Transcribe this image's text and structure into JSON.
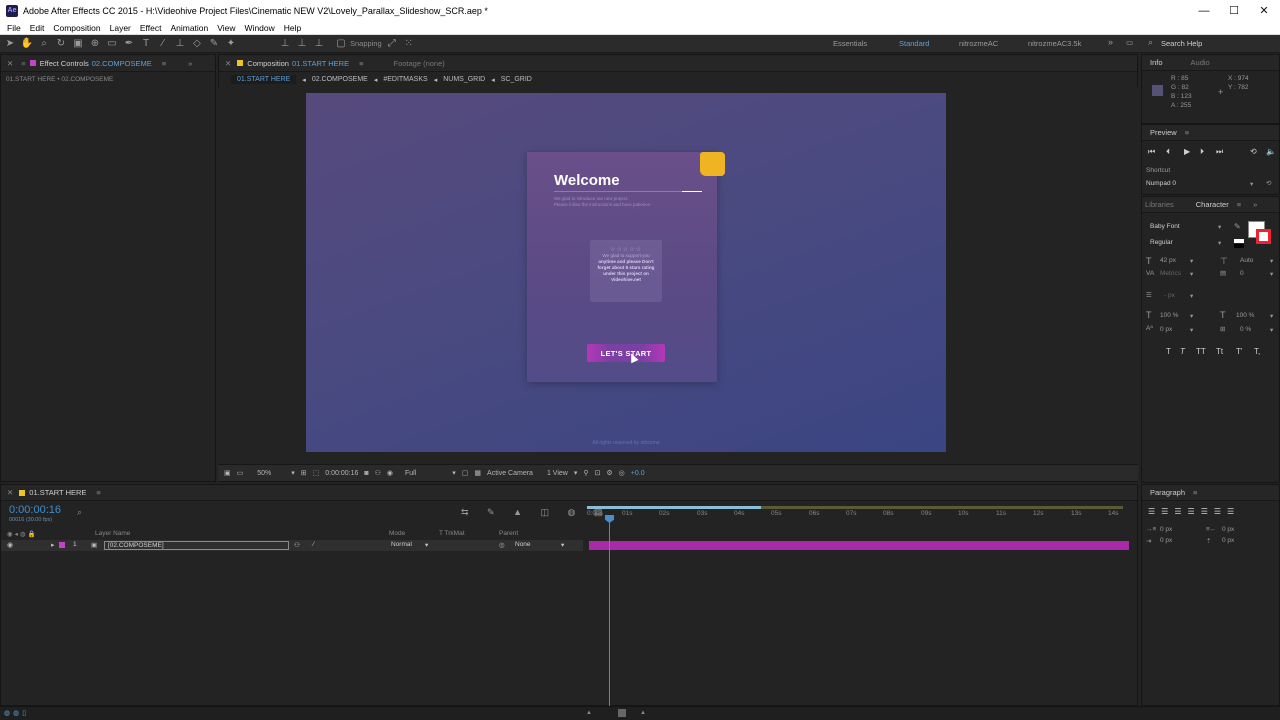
{
  "window": {
    "title": "Adobe After Effects CC 2015 - H:\\Videohive Project Files\\Cinematic NEW V2\\Lovely_Parallax_Slideshow_SCR.aep *",
    "app_icon": "Ae"
  },
  "menu": [
    "File",
    "Edit",
    "Composition",
    "Layer",
    "Effect",
    "Animation",
    "View",
    "Window",
    "Help"
  ],
  "toolbar": {
    "snapping_label": "Snapping",
    "workspaces": [
      "Essentials",
      "Standard",
      "nitrozmeAC",
      "nitrozmeAC3.5k"
    ],
    "active_workspace": "Standard",
    "search_placeholder": "Search Help"
  },
  "effect_controls": {
    "tab_label": "Effect Controls",
    "tab_target": "02.COMPOSEME",
    "breadcrumb": "01.START HERE • 02.COMPOSEME"
  },
  "composition": {
    "tab_label": "Composition",
    "tab_target": "01.START HERE",
    "footage_label": "Footage (none)",
    "nav_tabs": [
      "01.START HERE",
      "02.COMPOSEME",
      "#EDITMASKS",
      "NUMS_GRID",
      "SC_GRID"
    ],
    "active_nav": "01.START HERE"
  },
  "canvas": {
    "welcome_title": "Welcome",
    "intro_line1": "We glad to introduce our new project.",
    "intro_line2": "Please follow the instructions and have patience.",
    "stars": "☆☆☆☆☆",
    "rate_text1": "We glad to support you",
    "rate_text2": "anytime and please Don't",
    "rate_text3": "forget about 5 stars rating",
    "rate_text4": "under this project on",
    "rate_text5": "Videohive.net",
    "start_button": "LET'S START",
    "footnote": "All rights reserved by nitrozme",
    "corner_color": "#f0b321",
    "button_color": "#b537b8"
  },
  "comp_footer": {
    "zoom": "50%",
    "timecode": "0:00:00:16",
    "resolution": "Full",
    "camera": "Active Camera",
    "views": "1 View",
    "exposure": "+0.0"
  },
  "timeline": {
    "tab_label": "01.START HERE",
    "timecode": "0:00:00:16",
    "frame_info": "00016 (30.00 fps)",
    "col_layer_name": "Layer Name",
    "col_mode": "Mode",
    "col_trkmat": "T  TrkMat",
    "col_parent": "Parent",
    "layer_index": "1",
    "layer_name": "[02.COMPOSEME]",
    "layer_mode": "Normal",
    "layer_parent": "None",
    "ruler_ticks": [
      "0:00s",
      "01s",
      "02s",
      "03s",
      "04s",
      "05s",
      "06s",
      "07s",
      "08s",
      "09s",
      "10s",
      "11s",
      "12s",
      "13s",
      "14s"
    ]
  },
  "info": {
    "tab_info": "Info",
    "tab_audio": "Audio",
    "r": "R : 85",
    "g": "G : 82",
    "b": "B : 123",
    "a": "A : 255",
    "x": "X : 974",
    "y": "Y : 782",
    "swatch_color": "#555278"
  },
  "preview": {
    "tab_label": "Preview",
    "shortcut_label": "Shortcut",
    "shortcut_value": "Numpad 0"
  },
  "character": {
    "tab_libraries": "Libraries",
    "tab_character": "Character",
    "font_name": "Baby Font",
    "font_style": "Regular",
    "font_size": "42 px",
    "leading": "Auto",
    "kerning": "Metrics",
    "tracking": "0",
    "stroke": "- px",
    "vscale": "100 %",
    "hscale": "100 %",
    "baseline": "0 px",
    "tsume": "0 %",
    "style_buttons": [
      "T",
      "T",
      "TT",
      "Tt",
      "T'",
      "T,"
    ]
  },
  "paragraph": {
    "tab_label": "Paragraph",
    "indent1": "0 px",
    "indent2": "0 px",
    "indent3": "0 px",
    "indent4": "0 px"
  }
}
